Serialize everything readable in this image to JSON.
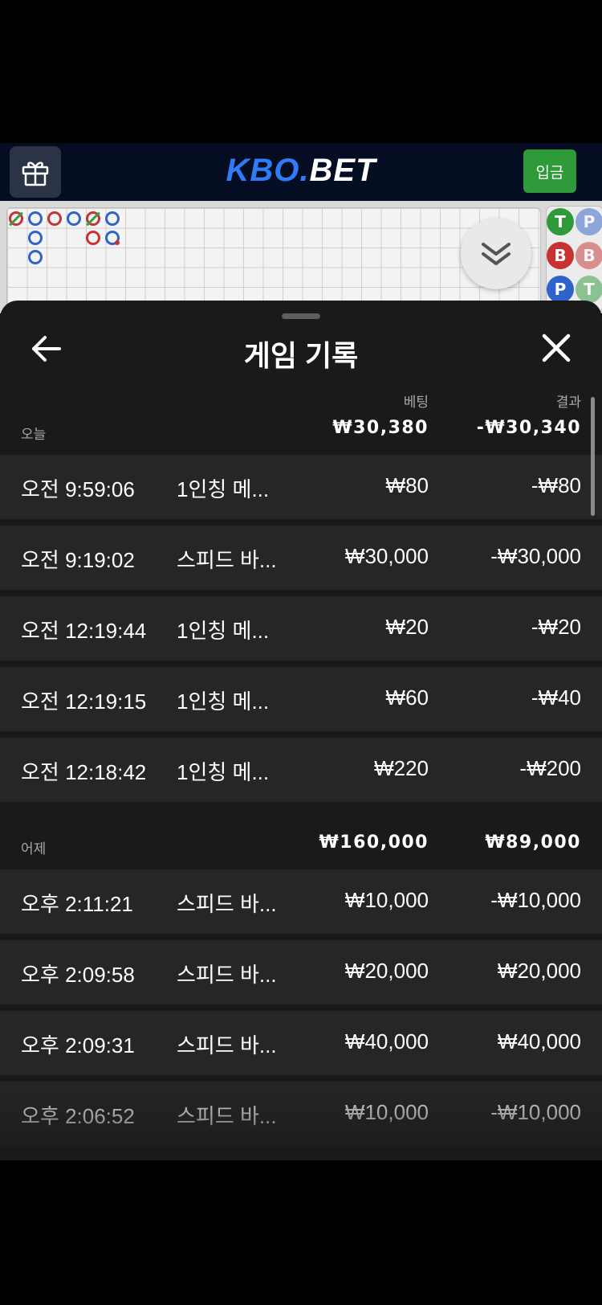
{
  "header": {
    "logo_part1": "KBO.",
    "logo_part2": "BET",
    "deposit_label": "입금",
    "gift_icon": "gift-icon",
    "logo_accent_color": "#2f7cf6",
    "deposit_color": "#2e9a3a"
  },
  "road": {
    "predictions": [
      "T",
      "P",
      "B",
      "B",
      "P",
      "T"
    ]
  },
  "history": {
    "title": "게임 기록",
    "columns": {
      "bet": "베팅",
      "result": "결과"
    },
    "groups": [
      {
        "label": "오늘",
        "bet_total": "₩30,380",
        "result_total": "-₩30,340",
        "rows": [
          {
            "time": "오전 9:59:06",
            "game": "1인칭 메...",
            "bet": "₩80",
            "result": "-₩80"
          },
          {
            "time": "오전 9:19:02",
            "game": "스피드 바...",
            "bet": "₩30,000",
            "result": "-₩30,000"
          },
          {
            "time": "오전 12:19:44",
            "game": "1인칭 메...",
            "bet": "₩20",
            "result": "-₩20"
          },
          {
            "time": "오전 12:19:15",
            "game": "1인칭 메...",
            "bet": "₩60",
            "result": "-₩40"
          },
          {
            "time": "오전 12:18:42",
            "game": "1인칭 메...",
            "bet": "₩220",
            "result": "-₩200"
          }
        ]
      },
      {
        "label": "어제",
        "bet_total": "₩160,000",
        "result_total": "₩89,000",
        "rows": [
          {
            "time": "오후 2:11:21",
            "game": "스피드 바...",
            "bet": "₩10,000",
            "result": "-₩10,000"
          },
          {
            "time": "오후 2:09:58",
            "game": "스피드 바...",
            "bet": "₩20,000",
            "result": "₩20,000"
          },
          {
            "time": "오후 2:09:31",
            "game": "스피드 바...",
            "bet": "₩40,000",
            "result": "₩40,000"
          },
          {
            "time": "오후 2:06:52",
            "game": "스피드 바...",
            "bet": "₩10,000",
            "result": "-₩10,000"
          }
        ]
      }
    ]
  }
}
